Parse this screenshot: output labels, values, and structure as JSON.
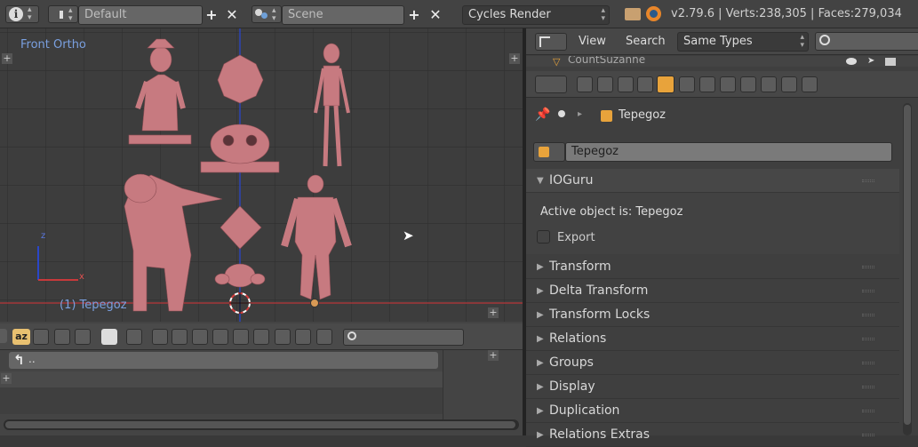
{
  "topbar": {
    "info_icon": "info-icon",
    "layout_name": "Default",
    "scene_name": "Scene",
    "render_engine": "Cycles Render",
    "stats": "v2.79.6 | Verts:238,305 | Faces:279,034"
  },
  "viewport": {
    "view_label": "Front Ortho",
    "object_label": "(1) Tepegoz",
    "axis_z": "z",
    "axis_x": "x"
  },
  "outliner": {
    "view_menu": "View",
    "search_menu": "Search",
    "filter_select": "Same Types",
    "partial_row": "CountSuzanne"
  },
  "properties": {
    "breadcrumb_object": "Tepegoz",
    "object_name": "Tepegoz",
    "addon_panel_title": "IOGuru",
    "active_object_text": "Active object is: Tepegoz",
    "export_label": "Export",
    "panels": [
      "Transform",
      "Delta Transform",
      "Transform Locks",
      "Relations",
      "Groups",
      "Display",
      "Duplication",
      "Relations Extras"
    ]
  },
  "file_browser": {
    "parent_dir": ".."
  },
  "colors": {
    "accent_orange": "#e8a33b",
    "model_pink": "#c77a80",
    "axis_red": "#c8393b",
    "axis_blue": "#2a46c8"
  }
}
